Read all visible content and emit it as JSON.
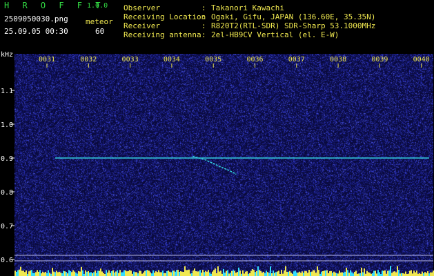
{
  "app": {
    "title": "H R O F F T",
    "version": "1.0.0"
  },
  "file": {
    "name": "2509050030.png",
    "datetime": "25.09.05 00:30"
  },
  "meteor": {
    "label": "meteor",
    "count": "60"
  },
  "info": [
    {
      "key": "Observer",
      "value": "Takanori Kawachi"
    },
    {
      "key": "Receiving Location",
      "value": "Ogaki, Gifu, JAPAN (136.60E, 35.35N)"
    },
    {
      "key": "Receiver",
      "value": "R820T2(RTL-SDR) SDR-Sharp 53.1000MHz"
    },
    {
      "key": "Receiving antenna",
      "value": "2el-HB9CV Vertical (el. E-W)"
    }
  ],
  "chart_data": {
    "type": "heatmap",
    "ylabel": "kHz",
    "ylim": [
      0.6,
      1.2
    ],
    "yticks": [
      "1.1",
      "1.0",
      "0.9",
      "0.8",
      "0.7",
      "0.6"
    ],
    "xticks": [
      "0031",
      "0032",
      "0033",
      "0034",
      "0035",
      "0036",
      "0037",
      "0038",
      "0039",
      "0040"
    ],
    "carrier_khz": 0.9,
    "meteor_trace": [
      {
        "minute": 34.5,
        "khz": 0.905
      },
      {
        "minute": 34.8,
        "khz": 0.895
      },
      {
        "minute": 35.1,
        "khz": 0.878
      },
      {
        "minute": 35.4,
        "khz": 0.862
      },
      {
        "minute": 35.55,
        "khz": 0.852
      }
    ],
    "colors": {
      "background": "#0a0a3c",
      "noise": "#2a30c8",
      "signal": "#33ccdd",
      "ticks": "#f0e850",
      "level": "#33ddff"
    }
  }
}
